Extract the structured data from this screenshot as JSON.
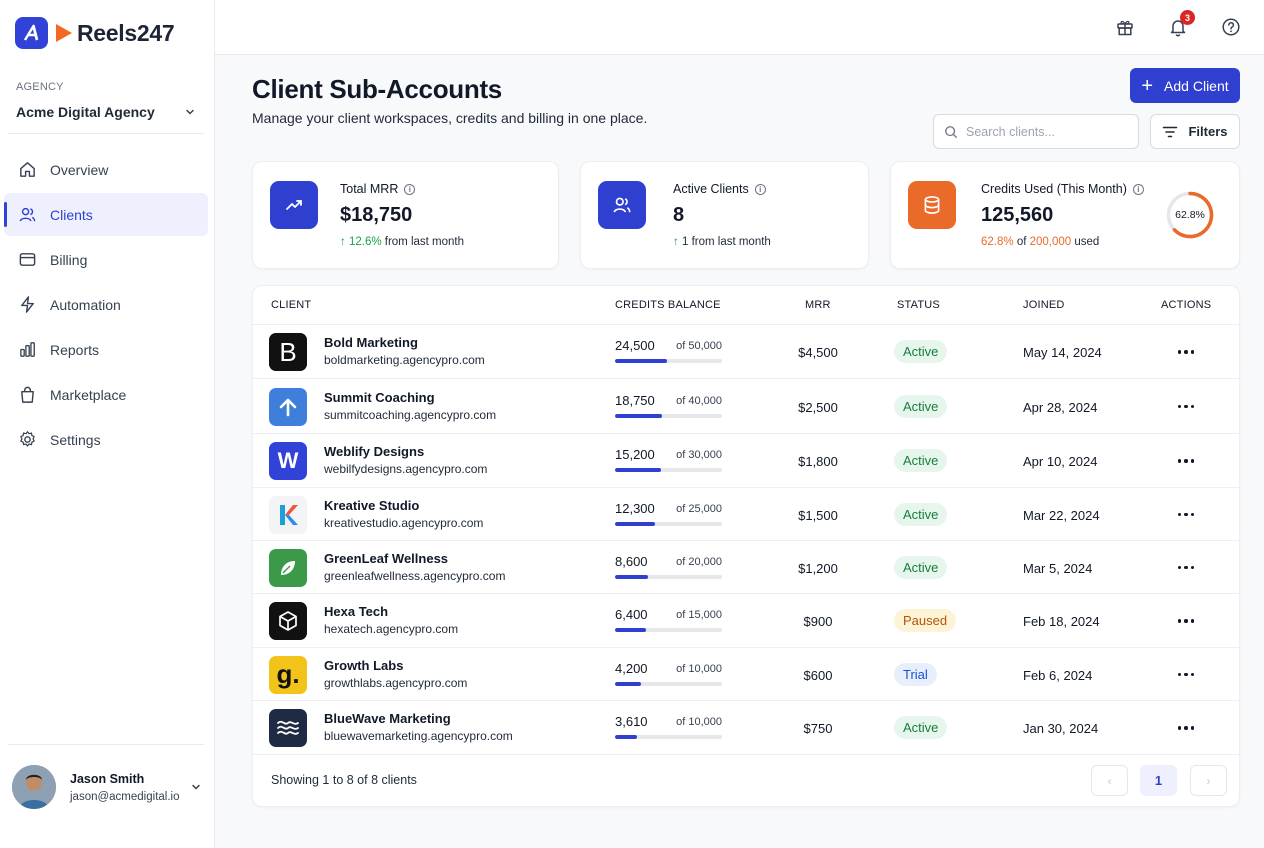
{
  "brand": {
    "name": "Reels247",
    "logo_letter": "A"
  },
  "agency": {
    "label": "AGENCY",
    "name": "Acme Digital Agency"
  },
  "nav": [
    {
      "label": "Overview",
      "icon": "home-icon"
    },
    {
      "label": "Clients",
      "icon": "users-icon",
      "active": true
    },
    {
      "label": "Billing",
      "icon": "credit-card-icon"
    },
    {
      "label": "Automation",
      "icon": "lightning-icon"
    },
    {
      "label": "Reports",
      "icon": "bar-chart-icon"
    },
    {
      "label": "Marketplace",
      "icon": "shopping-bag-icon"
    },
    {
      "label": "Settings",
      "icon": "gear-icon"
    }
  ],
  "user": {
    "name": "Jason Smith",
    "email": "jason@acmedigital.io"
  },
  "topbar": {
    "notification_count": "3"
  },
  "header": {
    "title": "Client Sub-Accounts",
    "subtitle": "Manage your client workspaces, credits and billing in one place.",
    "add_label": "Add Client",
    "search_placeholder": "Search clients...",
    "filters_label": "Filters"
  },
  "kpis": {
    "mrr": {
      "label": "Total MRR",
      "value": "$18,750",
      "delta": "12.6%",
      "delta_suffix": "from last month"
    },
    "clients": {
      "label": "Active Clients",
      "value": "8",
      "delta": "1",
      "delta_suffix": "from last month"
    },
    "credits": {
      "label": "Credits Used (This Month)",
      "value": "125,560",
      "pct_text": "62.8%",
      "of_text": "of",
      "total": "200,000",
      "used_text": "used",
      "ring_label": "62.8%",
      "pct": 0.628
    }
  },
  "table": {
    "headers": {
      "client": "CLIENT",
      "credits": "CREDITS BALANCE",
      "mrr": "MRR",
      "status": "STATUS",
      "joined": "JOINED",
      "actions": "ACTIONS"
    },
    "rows": [
      {
        "name": "Bold Marketing",
        "domain": "boldmarketing.agencypro.com",
        "balance": "24,500",
        "total": "of 50,000",
        "ratio": 0.49,
        "mrr": "$4,500",
        "status": "Active",
        "status_type": "active",
        "joined": "May 14, 2024",
        "logo": "B"
      },
      {
        "name": "Summit Coaching",
        "domain": "summitcoaching.agencypro.com",
        "balance": "18,750",
        "total": "of 40,000",
        "ratio": 0.44,
        "mrr": "$2,500",
        "status": "Active",
        "status_type": "active",
        "joined": "Apr 28, 2024",
        "logo": "↑"
      },
      {
        "name": "Weblify Designs",
        "domain": "webilfydesigns.agencypro.com",
        "balance": "15,200",
        "total": "of 30,000",
        "ratio": 0.43,
        "mrr": "$1,800",
        "status": "Active",
        "status_type": "active",
        "joined": "Apr 10, 2024",
        "logo": "W"
      },
      {
        "name": "Kreative Studio",
        "domain": "kreativestudio.agencypro.com",
        "balance": "12,300",
        "total": "of 25,000",
        "ratio": 0.37,
        "mrr": "$1,500",
        "status": "Active",
        "status_type": "active",
        "joined": "Mar 22, 2024",
        "logo": "K"
      },
      {
        "name": "GreenLeaf Wellness",
        "domain": "greenleafwellness.agencypro.com",
        "balance": "8,600",
        "total": "of 20,000",
        "ratio": 0.31,
        "mrr": "$1,200",
        "status": "Active",
        "status_type": "active",
        "joined": "Mar 5, 2024",
        "logo": ""
      },
      {
        "name": "Hexa Tech",
        "domain": "hexatech.agencypro.com",
        "balance": "6,400",
        "total": "of 15,000",
        "ratio": 0.29,
        "mrr": "$900",
        "status": "Paused",
        "status_type": "paused",
        "joined": "Feb 18, 2024",
        "logo": ""
      },
      {
        "name": "Growth Labs",
        "domain": "growthlabs.agencypro.com",
        "balance": "4,200",
        "total": "of 10,000",
        "ratio": 0.24,
        "mrr": "$600",
        "status": "Trial",
        "status_type": "trial",
        "joined": "Feb 6, 2024",
        "logo": "g."
      },
      {
        "name": "BlueWave Marketing",
        "domain": "bluewavemarketing.agencypro.com",
        "balance": "3,610",
        "total": "of 10,000",
        "ratio": 0.21,
        "mrr": "$750",
        "status": "Active",
        "status_type": "active",
        "joined": "Jan 30, 2024",
        "logo": ""
      }
    ],
    "footer": "Showing 1 to 8 of 8 clients",
    "page": "1"
  },
  "colors": {
    "accent": "#2f3fcf",
    "brand_play": "#f26a21",
    "active": "#15803d",
    "paused": "#b45309",
    "trial": "#1d4ed8",
    "credits_icon": "#ea6a2a"
  }
}
